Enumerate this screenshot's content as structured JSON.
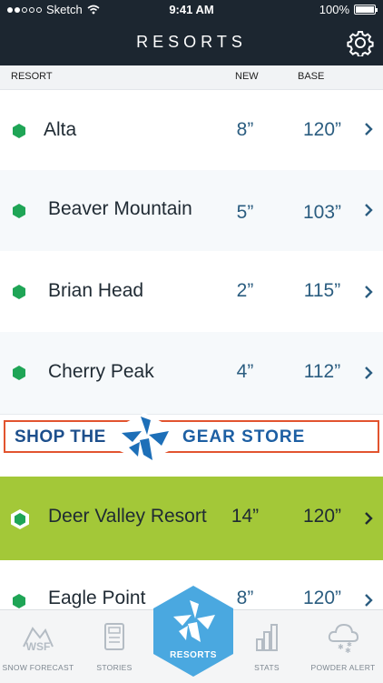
{
  "status_bar": {
    "carrier": "Sketch",
    "time": "9:41 AM",
    "battery": "100%"
  },
  "header": {
    "title": "RESORTS",
    "settings_icon": "gear-icon"
  },
  "columns": {
    "resort": "RESORT",
    "new": "NEW",
    "base": "BASE"
  },
  "rows": [
    {
      "name": "Alta",
      "new": "8”",
      "base": "120”",
      "highlighted": false
    },
    {
      "name": "Beaver Mountain",
      "new": "5”",
      "base": "103”",
      "highlighted": false
    },
    {
      "name": "Brian Head",
      "new": "2”",
      "base": "115”",
      "highlighted": false
    },
    {
      "name": "Cherry Peak",
      "new": "4”",
      "base": "112”",
      "highlighted": false
    },
    {
      "name": "Deer Valley Resort",
      "new": "14”",
      "base": "120”",
      "highlighted": true
    },
    {
      "name": "Eagle Point",
      "new": "8”",
      "base": "120”",
      "highlighted": false
    }
  ],
  "banner": {
    "left_text": "SHOP THE",
    "right_text": "GEAR STORE"
  },
  "tabs": [
    {
      "label": "SNOW FORECAST",
      "icon": "snow-forecast-icon",
      "icon_text": "WSF"
    },
    {
      "label": "STORIES",
      "icon": "stories-icon"
    },
    {
      "label": "RESORTS",
      "icon": "resorts-icon",
      "active": true
    },
    {
      "label": "STATS",
      "icon": "stats-icon"
    },
    {
      "label": "POWDER ALERT",
      "icon": "powder-alert-icon"
    }
  ],
  "colors": {
    "header_bg": "#1c2630",
    "accent_green": "#a3c838",
    "hex_green": "#1fa556",
    "value_blue": "#2b5d80",
    "tab_active": "#4aa8e0",
    "banner_border": "#e2542f"
  }
}
